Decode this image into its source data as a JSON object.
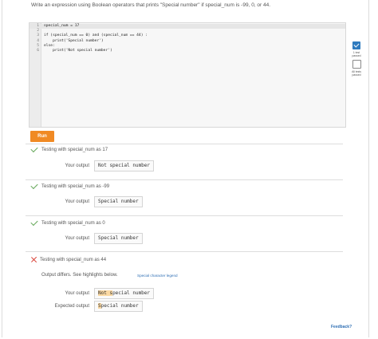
{
  "prompt": "Write an expression using Boolean operators that prints \"Special number\" if special_num is -99, 0, or 44.",
  "code": {
    "lines": [
      {
        "num": "1",
        "text": "special_num = 17"
      },
      {
        "num": "2",
        "text": ""
      },
      {
        "num": "3",
        "text": "if (special_num == 0) and (special_num == 44) :"
      },
      {
        "num": "4",
        "text": "    print('Special number')"
      },
      {
        "num": "5",
        "text": "else:"
      },
      {
        "num": "6",
        "text": "    print('Not special number')"
      }
    ]
  },
  "side": {
    "item1_label": "1 test passed",
    "item2_label": "All tests passed"
  },
  "run_label": "Run",
  "tests": [
    {
      "heading": "Testing with special_num as 17",
      "your_output_label": "Your output",
      "your_output": "Not special number"
    },
    {
      "heading": "Testing with special_num as -99",
      "your_output_label": "Your output",
      "your_output": "Special number"
    },
    {
      "heading": "Testing with special_num as 0",
      "your_output_label": "Your output",
      "your_output": "Special number"
    },
    {
      "heading": "Testing with special_num as 44",
      "diff_message": "Output differs. See highlights below.",
      "legend_link": "Special character legend",
      "your_output_label": "Your output",
      "your_output_hl": "Not s",
      "your_output_rest": "pecial number",
      "expected_label": "Expected output",
      "expected_hl": "S",
      "expected_rest": "pecial number"
    }
  ],
  "feedback_label": "Feedback?"
}
